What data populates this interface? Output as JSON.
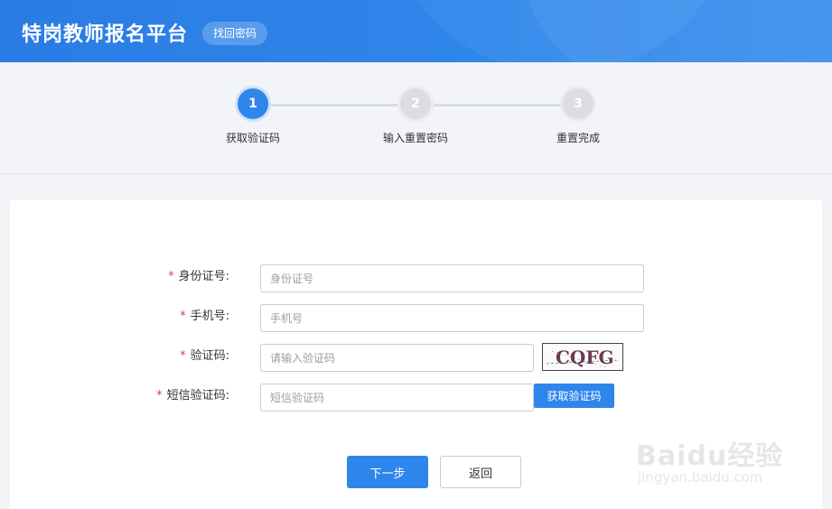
{
  "header": {
    "title": "特岗教师报名平台",
    "pill_label": "找回密码",
    "accent_color": "#2f86ea"
  },
  "steps": [
    {
      "number": "1",
      "label": "获取验证码",
      "active": true
    },
    {
      "number": "2",
      "label": "输入重置密码",
      "active": false
    },
    {
      "number": "3",
      "label": "重置完成",
      "active": false
    }
  ],
  "form": {
    "required_mark": "*",
    "id_card": {
      "label": "身份证号:",
      "placeholder": "身份证号",
      "value": ""
    },
    "phone": {
      "label": "手机号:",
      "placeholder": "手机号",
      "value": ""
    },
    "captcha": {
      "label": "验证码:",
      "placeholder": "请输入验证码",
      "value": "",
      "image_text": "CQFG"
    },
    "sms_code": {
      "label": "短信验证码:",
      "placeholder": "短信验证码",
      "value": "",
      "button_label": "获取验证码"
    }
  },
  "actions": {
    "next_label": "下一步",
    "back_label": "返回"
  },
  "watermark": {
    "brand": "Baidu经验",
    "url": "jingyan.baidu.com"
  }
}
